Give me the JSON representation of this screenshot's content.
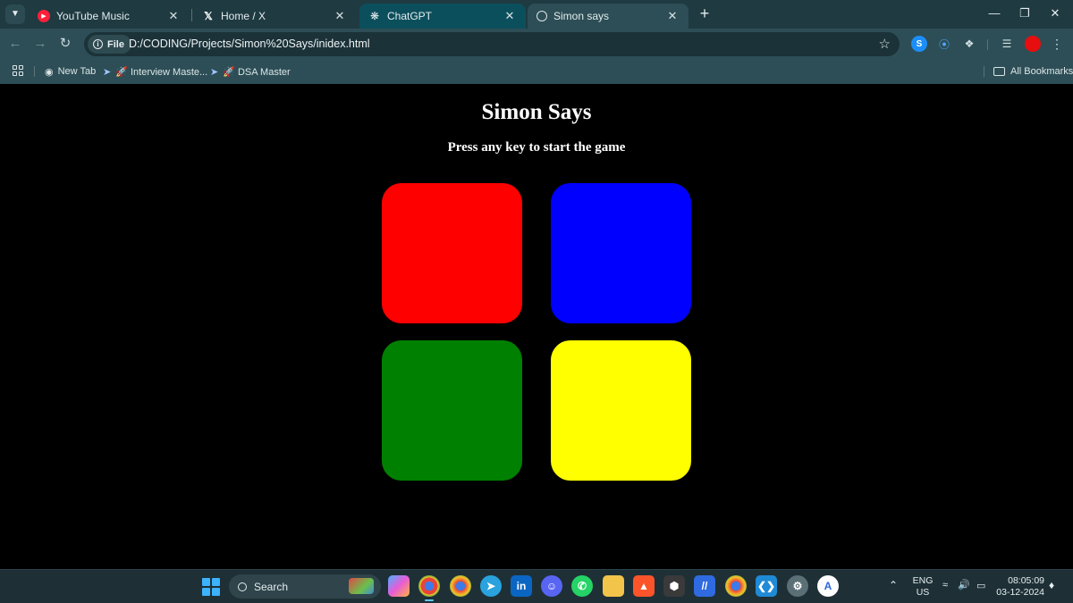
{
  "browser": {
    "tabs": [
      {
        "title": "YouTube Music",
        "favicon": "youtube-music-icon",
        "active": false
      },
      {
        "title": "Home / X",
        "favicon": "x-logo-icon",
        "active": false
      },
      {
        "title": "ChatGPT",
        "favicon": "chatgpt-icon",
        "active": false
      },
      {
        "title": "Simon says",
        "favicon": "globe-icon",
        "active": true
      }
    ],
    "toolbar": {
      "scheme_chip": "File",
      "url": "D:/CODING/Projects/Simon%20Says/inidex.html"
    },
    "bookmarks": [
      {
        "label": "New Tab",
        "icon": "globe-icon"
      },
      {
        "label": "🚀 Interview Maste...",
        "icon": "rocket-icon"
      },
      {
        "label": "🚀 DSA Master",
        "icon": "rocket-icon"
      }
    ],
    "all_bookmarks_label": "All Bookmarks"
  },
  "page": {
    "title": "Simon Says",
    "subtitle": "Press any key to start the game",
    "buttons": [
      {
        "color_name": "red",
        "color": "#ff0000"
      },
      {
        "color_name": "blue",
        "color": "#0000ff"
      },
      {
        "color_name": "green",
        "color": "#008000"
      },
      {
        "color_name": "yellow",
        "color": "#ffff00"
      }
    ]
  },
  "taskbar": {
    "search_label": "Search",
    "language": "ENG",
    "region": "US",
    "time": "08:05:09",
    "date": "03-12-2024"
  }
}
